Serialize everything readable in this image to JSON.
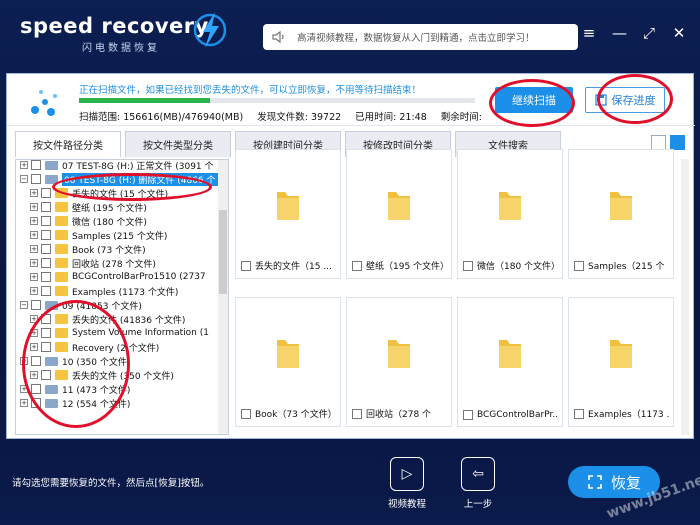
{
  "app": {
    "name": "speed recovery",
    "subtitle": "闪电数据恢复"
  },
  "notice": {
    "text": "高清视频教程，数据恢复从入门到精通，点击立即学习！"
  },
  "scan": {
    "message": "正在扫描文件，如果已经找到您丢失的文件，可以立即恢复，不用等待扫描结束！",
    "progress_fraction": 0.33,
    "range": "扫描范围: 156616(MB)/476940(MB)",
    "found": "发现文件数: 39722",
    "elapsed": "已用时间: 21:48",
    "remaining": "剩余时间:",
    "continue_label": "继续扫描",
    "save_label": "保存进度"
  },
  "tabs": [
    {
      "label": "按文件路径分类"
    },
    {
      "label": "按文件类型分类"
    },
    {
      "label": "按创建时间分类"
    },
    {
      "label": "按修改时间分类"
    },
    {
      "label": "文件搜索"
    }
  ],
  "tree": [
    {
      "label": "07 TEST-8G (H:) 正常文件 (3091 个"
    },
    {
      "label": "08 TEST-8G (H:) 删除文件 (4866 个"
    },
    {
      "label": "丢失的文件   (15 个文件)"
    },
    {
      "label": "壁纸   (195 个文件)"
    },
    {
      "label": "微信   (180 个文件)"
    },
    {
      "label": "Samples   (215 个文件)"
    },
    {
      "label": "Book   (73 个文件)"
    },
    {
      "label": "回收站   (278 个文件)"
    },
    {
      "label": "BCGControlBarPro1510   (2737"
    },
    {
      "label": "Examples   (1173 个文件)"
    },
    {
      "label": "09   (41853 个文件)"
    },
    {
      "label": "丢失的文件   (41836 个文件)"
    },
    {
      "label": "System Volume Information   (1"
    },
    {
      "label": "Recovery   (2 个文件)"
    },
    {
      "label": "10   (350 个文件)"
    },
    {
      "label": "丢失的文件   (350 个文件)"
    },
    {
      "label": "11   (473 个文件)"
    },
    {
      "label": "12   (554 个文件)"
    }
  ],
  "cards": [
    {
      "label": "丢失的文件（15 ..."
    },
    {
      "label": "壁纸（195 个文件）"
    },
    {
      "label": "微信（180 个文件）"
    },
    {
      "label": "Samples（215 个"
    },
    {
      "label": "Book（73 个文件）"
    },
    {
      "label": "回收站（278 个"
    },
    {
      "label": "BCGControlBarPr..."
    },
    {
      "label": "Examples（1173 ..."
    }
  ],
  "footer": {
    "hint": "请勾选您需要恢复的文件，然后点[恢复]按钮。",
    "video_label": "视频教程",
    "back_label": "上一步",
    "recover_label": "恢复",
    "watermark": "www.jb51.net"
  }
}
